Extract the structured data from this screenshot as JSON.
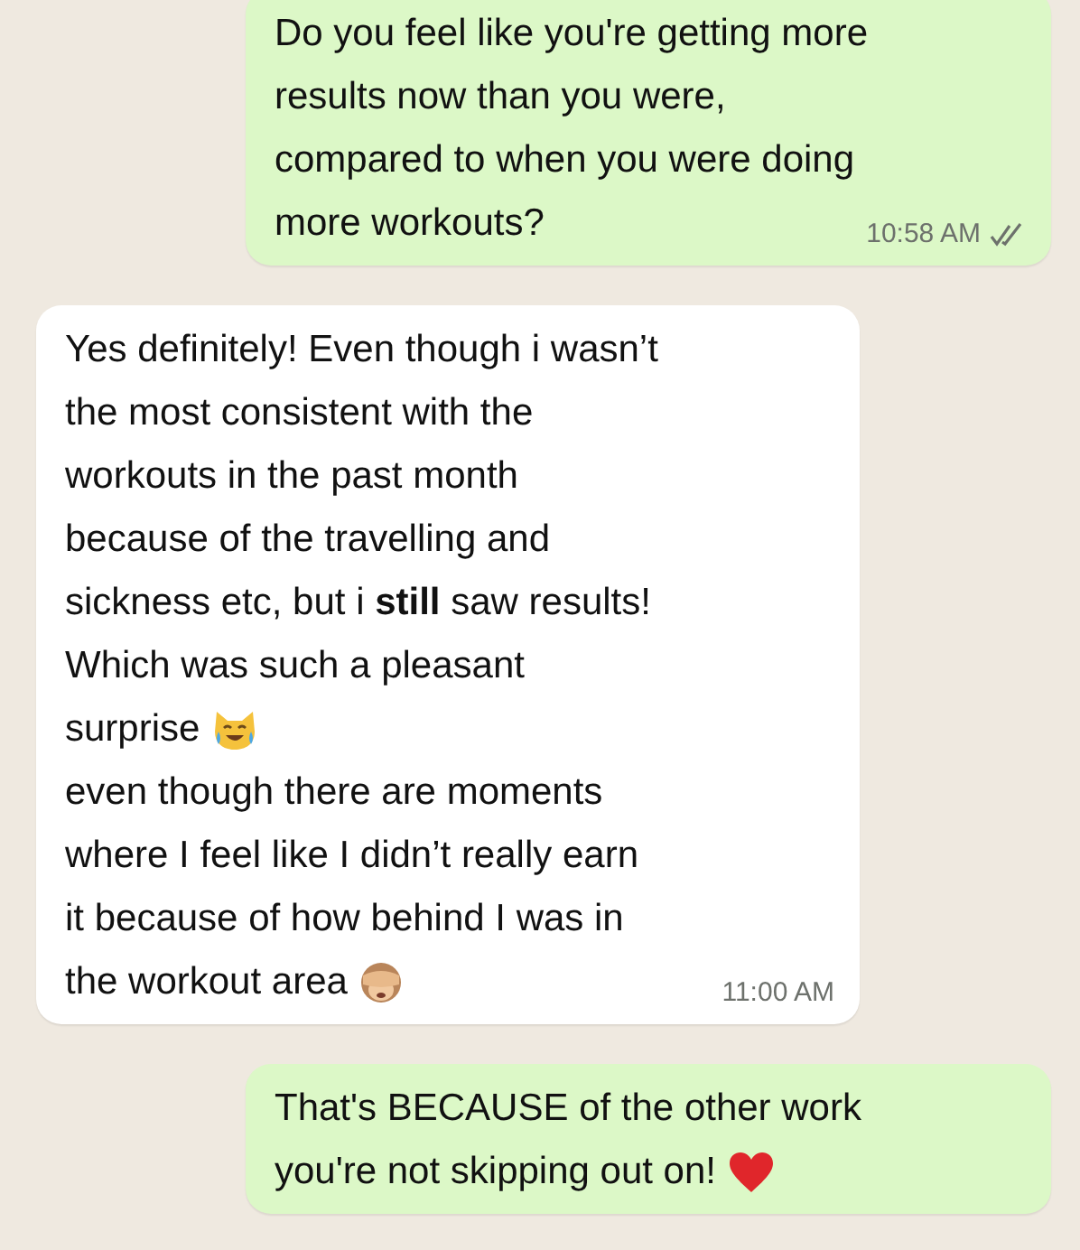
{
  "messages": [
    {
      "kind": "outgoing",
      "time": "10:58 AM",
      "read": false,
      "lines": [
        {
          "text": "Do you feel like you're getting more"
        },
        {
          "text": "results now than you were,"
        },
        {
          "text": "compared to when you were doing"
        },
        {
          "text": "more workouts?"
        }
      ]
    },
    {
      "kind": "incoming",
      "time": "11:00 AM",
      "lines": [
        {
          "text": "Yes definitely! Even though i wasn’t"
        },
        {
          "text": "the most consistent with the"
        },
        {
          "text": "workouts in the past month"
        },
        {
          "text": "because of the travelling and"
        },
        {
          "text": "sickness etc, but i **still** saw results!"
        },
        {
          "text": "Which was such a pleasant"
        },
        {
          "text": "surprise",
          "kind": "cat"
        },
        {
          "text": "even though there are moments"
        },
        {
          "text": "where I feel like I didn’t really earn"
        },
        {
          "text": "it because of how behind I was in"
        },
        {
          "text": "the workout area",
          "kind": "monkey"
        }
      ]
    },
    {
      "kind": "outgoing",
      "lines": [
        {
          "text": "That's BECAUSE of the other work"
        },
        {
          "text": "you're not skipping out on!",
          "kind": "heart"
        }
      ]
    }
  ]
}
